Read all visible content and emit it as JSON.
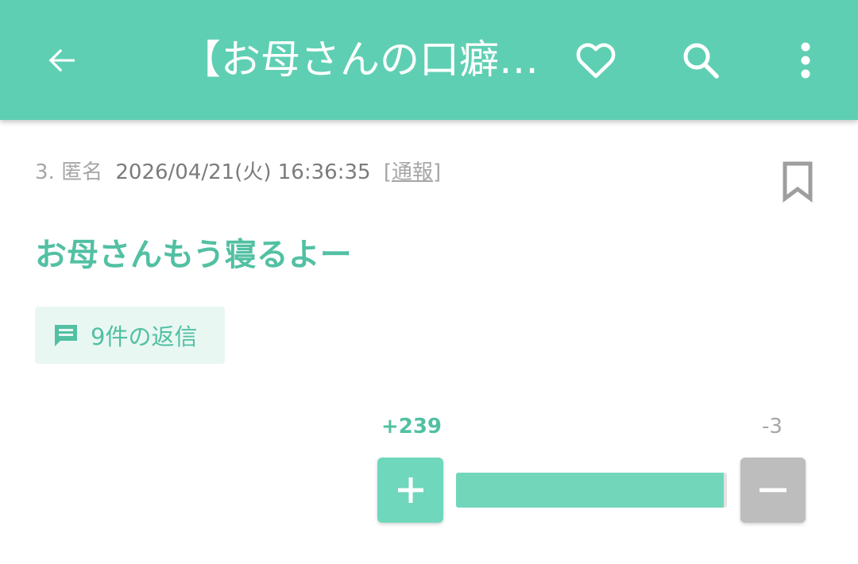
{
  "appbar": {
    "title": "【お母さんの口癖…",
    "back_icon": "back-arrow-icon",
    "favorite_icon": "heart-outline-icon",
    "search_icon": "search-icon",
    "more_icon": "more-vertical-icon",
    "background_color": "#5fcfb3"
  },
  "post": {
    "number": "3.",
    "author": "匿名",
    "datetime": "2026/04/21(火) 16:36:35",
    "report_label": "[通報]",
    "bookmark_icon": "bookmark-outline-icon",
    "body": "お母さんもう寝るよー",
    "replies": {
      "icon": "comment-icon",
      "label": "9件の返信"
    },
    "votes": {
      "plus_label": "+239",
      "minus_label": "-3",
      "plus_count": 239,
      "minus_count": 3,
      "plus_ratio": 0.9876,
      "plus_color": "#6fd7bc",
      "minus_color": "#bdbdbd"
    }
  }
}
